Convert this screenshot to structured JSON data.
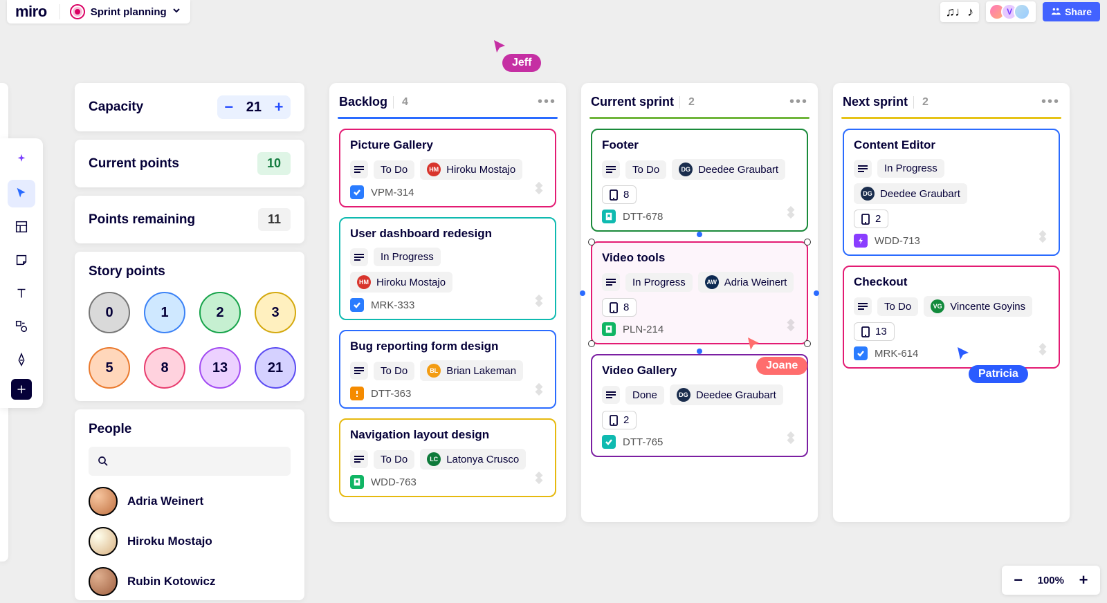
{
  "header": {
    "logo": "miro",
    "board_name": "Sprint planning",
    "share_label": "Share",
    "avatar_letter": "V"
  },
  "cursors": {
    "jeff": "Jeff",
    "joane": "Joane",
    "patricia": "Patricia"
  },
  "side_panel": {
    "capacity": {
      "label": "Capacity",
      "value": "21"
    },
    "current_points": {
      "label": "Current points",
      "value": "10"
    },
    "points_remaining": {
      "label": "Points remaining",
      "value": "11"
    },
    "story_points": {
      "label": "Story points",
      "values": [
        "0",
        "1",
        "2",
        "3",
        "5",
        "8",
        "13",
        "21"
      ]
    },
    "people": {
      "label": "People",
      "list": [
        {
          "name": "Adria Weinert"
        },
        {
          "name": "Hiroku Mostajo"
        },
        {
          "name": "Rubin Kotowicz"
        }
      ]
    }
  },
  "columns": {
    "backlog": {
      "title": "Backlog",
      "count": "4",
      "cards": [
        {
          "title": "Picture Gallery",
          "status": "To Do",
          "assignee": "Hiroku Mostajo",
          "assignee_init": "HM",
          "key": "VPM-314"
        },
        {
          "title": "User dashboard redesign",
          "status": "In Progress",
          "assignee": "Hiroku Mostajo",
          "assignee_init": "HM",
          "key": "MRK-333"
        },
        {
          "title": "Bug reporting form design",
          "status": "To Do",
          "assignee": "Brian Lakeman",
          "assignee_init": "BL",
          "key": "DTT-363"
        },
        {
          "title": "Navigation layout design",
          "status": "To Do",
          "assignee": "Latonya Crusco",
          "assignee_init": "LC",
          "key": "WDD-763"
        }
      ]
    },
    "current": {
      "title": "Current sprint",
      "count": "2",
      "cards": [
        {
          "title": "Footer",
          "status": "To Do",
          "assignee": "Deedee Graubart",
          "assignee_init": "DG",
          "points": "8",
          "key": "DTT-678"
        },
        {
          "title": "Video tools",
          "status": "In Progress",
          "assignee": "Adria Weinert",
          "assignee_init": "AW",
          "points": "8",
          "key": "PLN-214"
        },
        {
          "title": "Video Gallery",
          "status": "Done",
          "assignee": "Deedee Graubart",
          "assignee_init": "DG",
          "points": "2",
          "key": "DTT-765"
        }
      ]
    },
    "next": {
      "title": "Next sprint",
      "count": "2",
      "cards": [
        {
          "title": "Content Editor",
          "status": "In Progress",
          "assignee": "Deedee Graubart",
          "assignee_init": "DG",
          "points": "2",
          "key": "WDD-713"
        },
        {
          "title": "Checkout",
          "status": "To Do",
          "assignee": "Vincente Goyins",
          "assignee_init": "VG",
          "points": "13",
          "key": "MRK-614"
        }
      ]
    }
  },
  "zoom": {
    "value": "100%"
  }
}
